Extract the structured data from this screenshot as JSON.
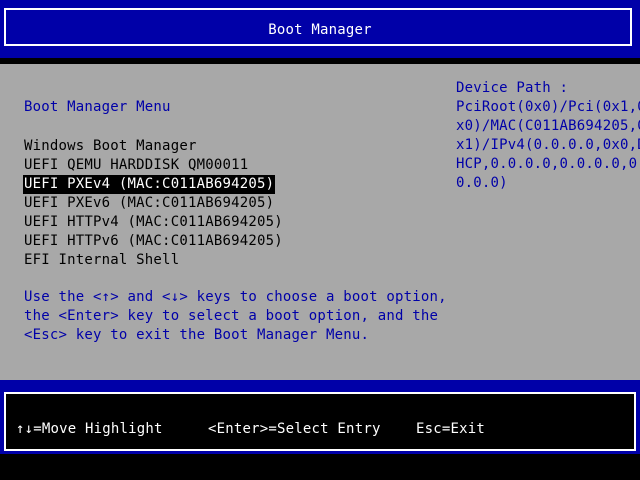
{
  "header": {
    "title": "Boot Manager"
  },
  "menu": {
    "title": "Boot Manager Menu",
    "items": [
      {
        "label": "Windows Boot Manager",
        "selected": false
      },
      {
        "label": "UEFI QEMU HARDDISK QM00011",
        "selected": false
      },
      {
        "label": "UEFI PXEv4 (MAC:C011AB694205)",
        "selected": true
      },
      {
        "label": "UEFI PXEv6 (MAC:C011AB694205)",
        "selected": false
      },
      {
        "label": "UEFI HTTPv4 (MAC:C011AB694205)",
        "selected": false
      },
      {
        "label": "UEFI HTTPv6 (MAC:C011AB694205)",
        "selected": false
      },
      {
        "label": "EFI Internal Shell",
        "selected": false
      }
    ]
  },
  "help": {
    "lines": [
      "Use the <↑> and <↓> keys to choose a boot option,",
      "the <Enter> key to select a boot option, and the",
      "<Esc> key to exit the Boot Manager Menu."
    ]
  },
  "device_path": {
    "label": "Device Path :",
    "lines": [
      "PciRoot(0x0)/Pci(0x1,0",
      "x0)/MAC(C011AB694205,0",
      "x1)/IPv4(0.0.0.0,0x0,D",
      "HCP,0.0.0.0,0.0.0.0,0.",
      "0.0.0)"
    ]
  },
  "footer": {
    "move_hint": "↑↓=Move Highlight",
    "enter_hint": "<Enter>=Select Entry",
    "esc_hint": "Esc=Exit"
  },
  "colors": {
    "bios_blue": "#0000a8",
    "panel_grey": "#a8a8a8",
    "text_white": "#ffffff",
    "highlight_black": "#000000"
  }
}
